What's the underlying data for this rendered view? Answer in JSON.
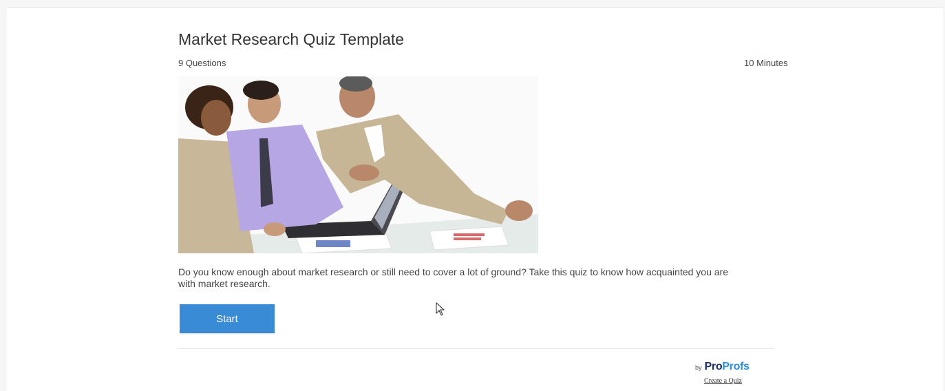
{
  "quiz": {
    "title": "Market Research Quiz Template",
    "question_count": "9 Questions",
    "duration": "10 Minutes",
    "description": "Do you know enough about market research or still need to cover a lot of ground? Take this quiz to know how acquainted you are with market research.",
    "start_label": "Start"
  },
  "footer": {
    "by_label": "by",
    "brand_part1": "Pro",
    "brand_part2": "Profs",
    "create_link": "Create a Quiz"
  },
  "colors": {
    "start_button": "#3a8bd6",
    "brand_dark": "#1c2f6b",
    "brand_light": "#2e8fe0"
  }
}
